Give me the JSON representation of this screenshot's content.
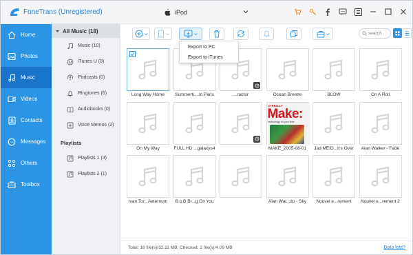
{
  "app": {
    "title": "FoneTrans (Unregistered)",
    "brand_color": "#2b94e4"
  },
  "device": {
    "name": "iPod",
    "icon": "apple-icon"
  },
  "titlebar_icons": [
    "cart-icon",
    "key-icon",
    "facebook-icon",
    "chat-icon",
    "menu-icon",
    "minimize-icon",
    "maximize-icon",
    "close-icon"
  ],
  "nav": {
    "items": [
      {
        "label": "Home",
        "icon": "home-icon"
      },
      {
        "label": "Photos",
        "icon": "photos-icon"
      },
      {
        "label": "Music",
        "icon": "music-icon",
        "active": true
      },
      {
        "label": "Videos",
        "icon": "videos-icon"
      },
      {
        "label": "Contacts",
        "icon": "contacts-icon"
      },
      {
        "label": "Messages",
        "icon": "messages-icon"
      },
      {
        "label": "Others",
        "icon": "others-icon"
      },
      {
        "label": "Toolbox",
        "icon": "toolbox-icon"
      }
    ]
  },
  "subnav": {
    "header": "All Music (18)",
    "items": [
      {
        "label": "Music (10)",
        "icon": "music-note-icon"
      },
      {
        "label": "iTunes U (0)",
        "icon": "itunes-u-icon"
      },
      {
        "label": "Podcasts (0)",
        "icon": "podcast-icon"
      },
      {
        "label": "Ringtones (6)",
        "icon": "bell-icon"
      },
      {
        "label": "Audiobooks (0)",
        "icon": "book-icon"
      },
      {
        "label": "Voice Memos (2)",
        "icon": "voice-memo-icon"
      }
    ],
    "playlists_title": "Playlists",
    "playlists": [
      {
        "label": "Playlists 1 (3)"
      },
      {
        "label": "Playlists 2 (1)"
      }
    ]
  },
  "toolbar": {
    "search_placeholder": "search",
    "export_menu": [
      "Export to PC",
      "Export to iTunes"
    ]
  },
  "tracks": [
    {
      "name": "Long Way Home",
      "selected": true
    },
    {
      "name": "Summerti....ln Paris"
    },
    {
      "name": "...ractor",
      "badge": true
    },
    {
      "name": "Ocean Breeze"
    },
    {
      "name": "BLOW"
    },
    {
      "name": "On A Roll"
    },
    {
      "name": "On My Way"
    },
    {
      "name": "FULL HD ...galaxys4"
    },
    {
      "name": "",
      "badge": true
    },
    {
      "name": "MAKE_2005-08-01",
      "cover": true
    },
    {
      "name": "Jad MEID...lt's Over"
    },
    {
      "name": "Alan Walker - Fade"
    },
    {
      "name": "Ivan Tor...Aeternum"
    },
    {
      "name": "B.o.B Br...g On You"
    },
    {
      "name": ""
    },
    {
      "name": "Alan Wal...do - Sky"
    },
    {
      "name": "Nouvel e...rement"
    },
    {
      "name": "Nouvel e...rement 2"
    }
  ],
  "cover": {
    "publisher": "O'REILLY",
    "title": "Make:",
    "subtitle": "technology on your time"
  },
  "status": {
    "summary": "Total: 18 file(s)/32.11 MB; Checked: 2 file(s)/4.09 MB",
    "link": "Data lost?"
  }
}
